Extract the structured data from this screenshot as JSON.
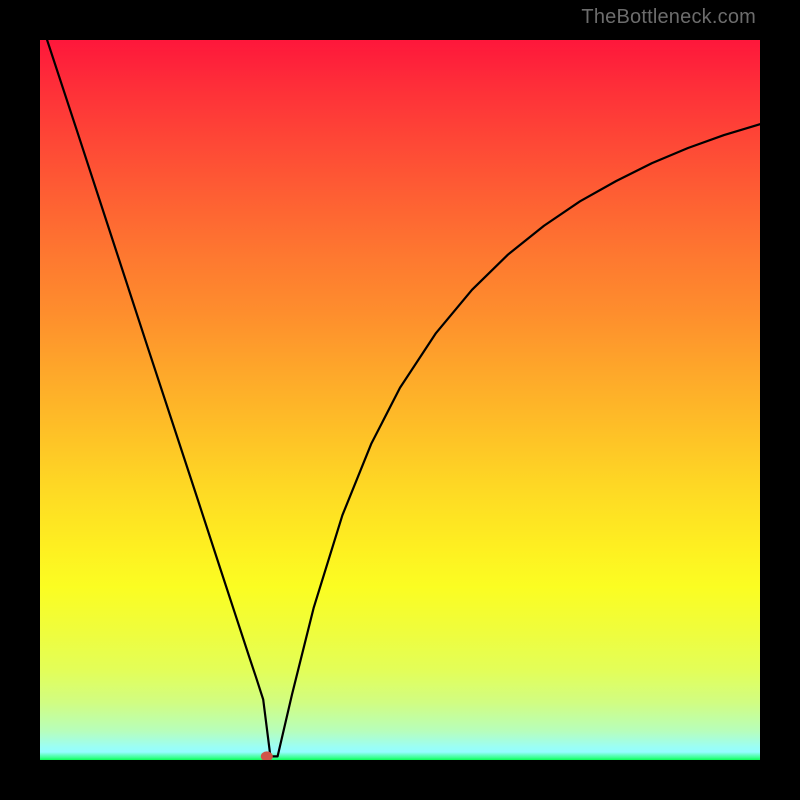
{
  "watermark": "TheBottleneck.com",
  "chart_data": {
    "type": "line",
    "title": "",
    "xlabel": "",
    "ylabel": "",
    "x": [
      0,
      5,
      10,
      15,
      20,
      22,
      25,
      27,
      29,
      30,
      31,
      32,
      33,
      35,
      38,
      42,
      46,
      50,
      55,
      60,
      65,
      70,
      75,
      80,
      85,
      90,
      95,
      100
    ],
    "y": [
      103,
      87.8,
      72.5,
      57.2,
      42.0,
      35.9,
      26.7,
      20.6,
      14.5,
      11.5,
      8.4,
      0.5,
      0.5,
      9.1,
      21.1,
      34.0,
      43.9,
      51.7,
      59.3,
      65.3,
      70.2,
      74.2,
      77.6,
      80.4,
      82.9,
      85.0,
      86.8,
      88.3
    ],
    "xlim": [
      0,
      100
    ],
    "ylim": [
      0,
      100
    ],
    "marker": {
      "x": 31.5,
      "y": 0.5
    },
    "gradient_stops": [
      {
        "pos": 0,
        "color": "#fe173b"
      },
      {
        "pos": 0.3,
        "color": "#fe7830"
      },
      {
        "pos": 0.55,
        "color": "#fec426"
      },
      {
        "pos": 0.76,
        "color": "#fbfd22"
      },
      {
        "pos": 0.92,
        "color": "#d1fd82"
      },
      {
        "pos": 0.99,
        "color": "#9bfef4"
      },
      {
        "pos": 1.0,
        "color": "#0bfe57"
      }
    ]
  }
}
